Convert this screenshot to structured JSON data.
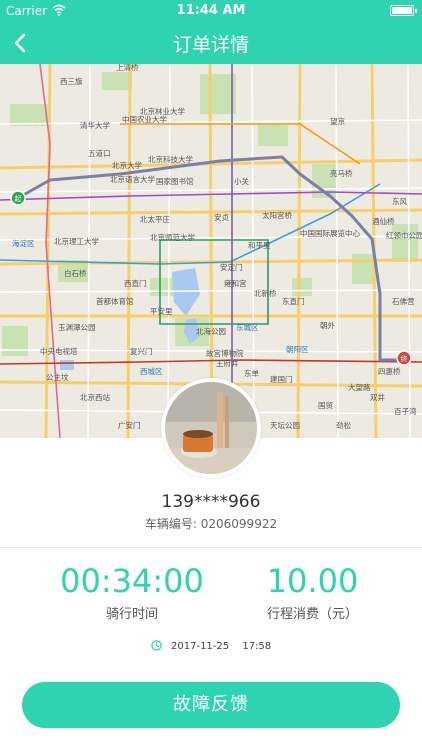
{
  "status_bar": {
    "carrier": "Carrier",
    "time": "11:44 AM"
  },
  "nav": {
    "title": "订单详情"
  },
  "map": {
    "labels": {
      "l1": "上清桥",
      "l2": "北京林业大学",
      "l3": "西三旗",
      "l4": "清华大学",
      "l5": "中国农业大学",
      "l6": "五道口",
      "l7": "北京科技大学",
      "l8": "北京语言大学",
      "l9": "北京大学",
      "l10": "国家图书馆",
      "l11": "海淀区",
      "l12": "北京理工大学",
      "l13": "北太平庄",
      "l14": "北京师范大学",
      "l15": "安贞",
      "l16": "太阳宫桥",
      "l17": "中国国际展览中心",
      "l18": "和平里",
      "l19": "安定门",
      "l20": "雍和宫",
      "l21": "北新桥",
      "l22": "东直门",
      "l23": "东城区",
      "l24": "西直门",
      "l25": "北海公园",
      "l26": "故宫博物院",
      "l27": "朝阳区",
      "l28": "西城区",
      "l29": "王府井",
      "l30": "建国门",
      "l31": "东单",
      "l32": "北京西站",
      "l33": "大望路",
      "l34": "百子湾",
      "l35": "四惠桥",
      "l36": "亮马桥",
      "l37": "酒仙桥",
      "l38": "望京",
      "l39": "国贸",
      "l40": "小关",
      "l41": "首都体育馆",
      "l42": "公主坟",
      "l43": "中央电视塔",
      "l44": "玉渊潭公园",
      "l45": "白石桥",
      "l46": "红领巾公园",
      "l47": "石佛营",
      "l48": "东风",
      "l49": "平安里",
      "l50": "复兴门",
      "l51": "广安门",
      "l52": "天坛公园",
      "l53": "劲松",
      "l54": "双井",
      "l55": "朝外",
      "start": "起",
      "end": "终"
    }
  },
  "order": {
    "phone": "139****966",
    "vehicle_label": "车辆编号:",
    "vehicle_no": "0206099922",
    "duration_value": "00:34:00",
    "duration_label": "骑行时间",
    "fee_value": "10.00",
    "fee_label": "行程消费（元）",
    "date": "2017-11-25",
    "time": "17:58",
    "feedback_button": "故障反馈"
  },
  "colors": {
    "accent": "#2ed4b0",
    "route": "#7a7fa8"
  },
  "icons": {
    "back": "chevron-left-icon",
    "clock": "clock-icon",
    "wifi": "wifi-icon",
    "battery": "battery-icon"
  }
}
